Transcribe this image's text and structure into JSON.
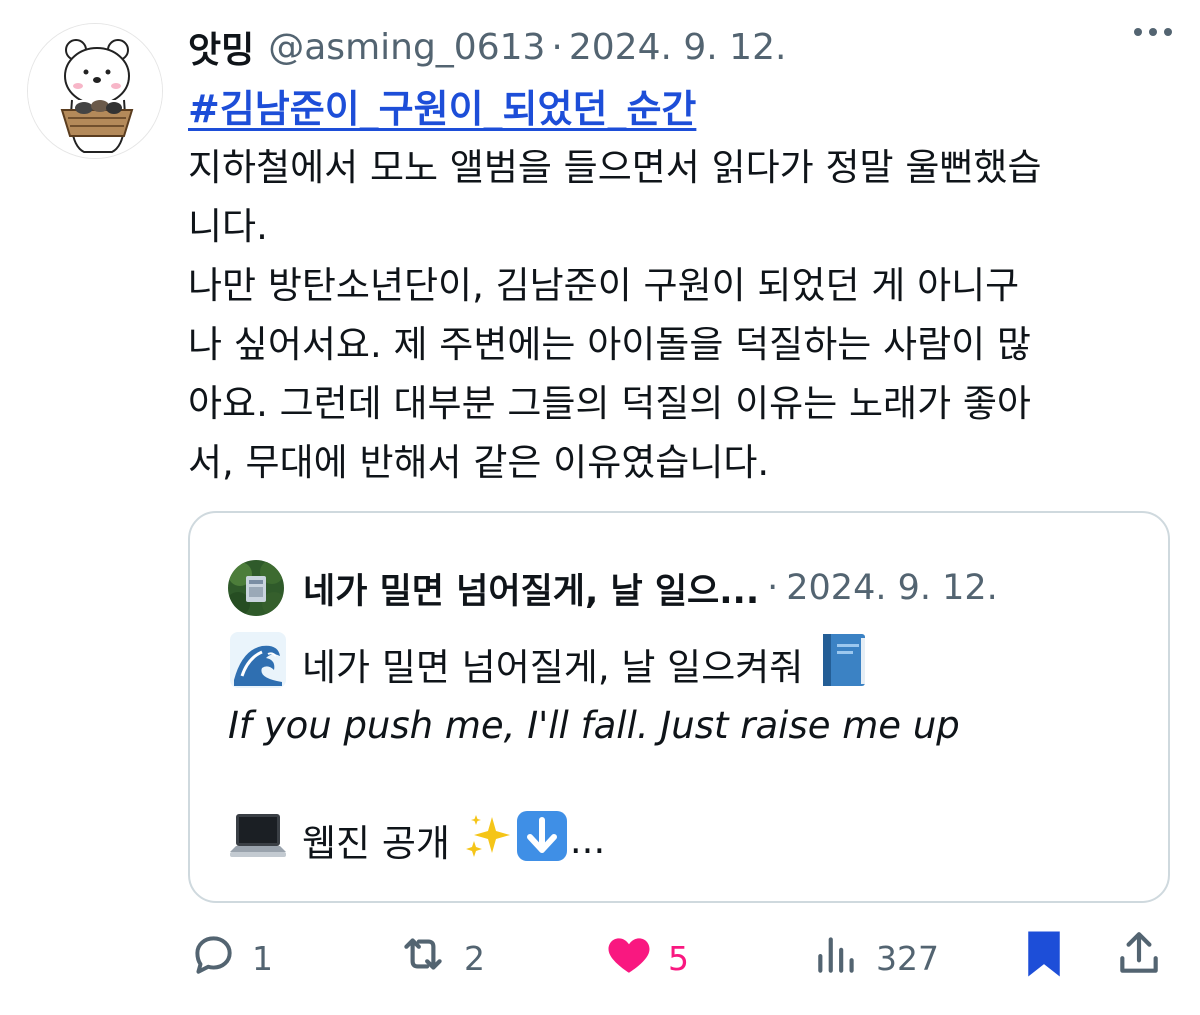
{
  "post": {
    "display_name": "앗밍",
    "handle": "@asming_0613",
    "separator": "·",
    "date": "2024. 9. 12.",
    "hashtag": "#김남준이_구원이_되었던_순간",
    "body_lines": [
      "지하철에서 모노 앨범을 들으면서 읽다가 정말 울뻔했습",
      "니다.",
      "나만 방탄소년단이, 김남준이 구원이 되었던 게 아니구",
      "나 싶어서요. 제 주변에는 아이돌을 덕질하는 사람이 많",
      "아요. 그런데 대부분 그들의 덕질의 이유는  노래가 좋아",
      "서, 무대에 반해서 같은 이유였습니다."
    ]
  },
  "quote": {
    "display_name": "네가 밀면 넘어질게, 날 일으...",
    "separator": "·",
    "date": "2024. 9. 12.",
    "line1_text": "네가 밀면 넘어질게, 날 일으켜줘",
    "line2_text": "If you push me, I'll fall. Just raise me up",
    "line3_text": "웹진 공개",
    "line3_ellipsis": "..."
  },
  "actions": {
    "replies": "1",
    "reposts": "2",
    "likes": "5",
    "views": "327"
  },
  "colors": {
    "text": "#0f1419",
    "secondary": "#536471",
    "link": "#1d4ed8",
    "like": "#f91880",
    "bookmark": "#1d4ed8",
    "border": "#cfd9de"
  },
  "icons": [
    "more-icon",
    "wave-emoji-icon",
    "blue-book-emoji-icon",
    "laptop-emoji-icon",
    "sparkles-emoji-icon",
    "down-arrow-emoji-icon",
    "reply-icon",
    "repost-icon",
    "heart-icon",
    "views-icon",
    "bookmark-icon",
    "share-icon"
  ]
}
